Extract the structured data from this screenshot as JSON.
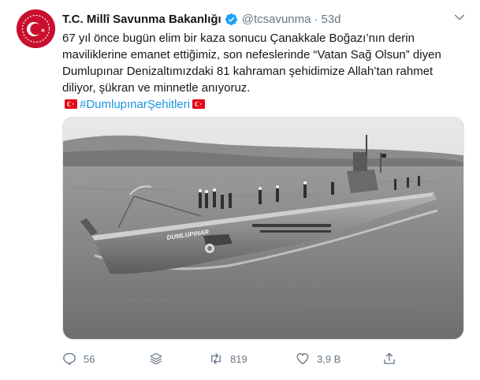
{
  "tweet": {
    "author": {
      "name": "T.C. Millî Savunma Bakanlığı",
      "handle": "@tcsavunma",
      "separator": "·",
      "time": "53d",
      "verified": true,
      "avatar_icon": "ministry-crescent-star-logo"
    },
    "text_line1": "67 yıl önce bugün elim bir kaza sonucu Çanakkale Boğazı’nın derin",
    "text_line2": "maviliklerine emanet ettiğimiz, son nefeslerinde “Vatan Sağ Olsun” diyen",
    "text_line3": "Dumlupınar Denizaltımızdaki 81 kahraman şehidimize Allah’tan rahmet",
    "text_line4": "diliyor, şükran ve minnetle anıyoruz.",
    "hashtag": "#DumlupınarŞehitleri",
    "flag_icon": "turkish-flag-emoji",
    "photo_hull_text": "DUMLUPINAR",
    "actions": {
      "reply_count": "56",
      "retweet_count": "819",
      "like_count": "3,9 B",
      "share_icon": "share-icon",
      "stack_icon": "layers-icon"
    }
  },
  "colors": {
    "brand_blue": "#1da1f2",
    "link": "#1b95e0",
    "muted": "#657786",
    "flag_red": "#e30a17"
  }
}
